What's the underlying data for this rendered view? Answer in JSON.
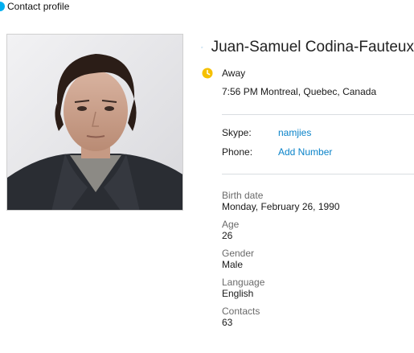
{
  "window": {
    "title": "Contact profile"
  },
  "profile": {
    "name": "Juan-Samuel Codina-Fauteux",
    "status": "Away",
    "local_time": "7:56 PM Montreal, Quebec, Canada",
    "avatar_icon": "profile-photo"
  },
  "accounts": {
    "skype_label": "Skype:",
    "skype_value": "namjies",
    "phone_label": "Phone:",
    "phone_value": "Add Number"
  },
  "details": [
    {
      "label": "Birth date",
      "value": "Monday, February 26, 1990"
    },
    {
      "label": "Age",
      "value": "26"
    },
    {
      "label": "Gender",
      "value": "Male"
    },
    {
      "label": "Language",
      "value": "English"
    },
    {
      "label": "Contacts",
      "value": "63"
    }
  ],
  "colors": {
    "accent": "#00aff0",
    "link": "#0a83c9",
    "away": "#f5c000",
    "star_outline": "#5aa7d8"
  }
}
